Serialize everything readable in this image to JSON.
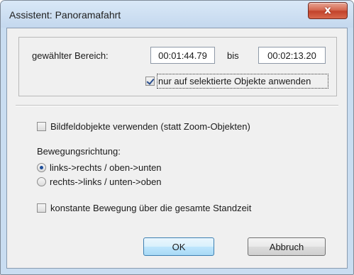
{
  "window": {
    "title": "Assistent: Panoramafahrt",
    "close_label": "x"
  },
  "range": {
    "label": "gewählter Bereich:",
    "start": "00:01:44.79",
    "to_label": "bis",
    "end": "00:02:13.20",
    "selected_only_label": "nur auf selektierte Objekte anwenden",
    "selected_only_checked": true
  },
  "options": {
    "image_field_label": "Bildfeldobjekte verwenden (statt Zoom-Objekten)",
    "image_field_checked": false,
    "direction_label": "Bewegungsrichtung:",
    "directions": [
      {
        "label": "links->rechts / oben->unten",
        "selected": true
      },
      {
        "label": "rechts->links / unten->oben",
        "selected": false
      }
    ],
    "constant_motion_label": "konstante Bewegung über die gesamte Standzeit",
    "constant_motion_checked": false
  },
  "buttons": {
    "ok": "OK",
    "cancel": "Abbruch"
  }
}
